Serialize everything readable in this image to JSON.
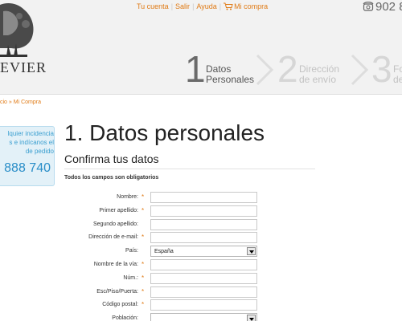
{
  "header": {
    "logo_word": "EVIER",
    "top_links": [
      "Tu cuenta",
      "Salir",
      "Ayuda"
    ],
    "cart_link": "Mi compra",
    "phone": "902 8",
    "steps": [
      {
        "num": "1",
        "line1": "Datos",
        "line2": "Personales",
        "state": "active"
      },
      {
        "num": "2",
        "line1": "Dirección",
        "line2": "de envío",
        "state": "inactive"
      },
      {
        "num": "3",
        "line1": "Fo",
        "line2": "de",
        "state": "inactive"
      }
    ]
  },
  "breadcrumb": {
    "parent": "cio",
    "separator": "»",
    "current": "Mi Compra"
  },
  "help_box": {
    "text": "lquier incidencia\ns e indícanos el\nde pedido",
    "phone": "888 740"
  },
  "main": {
    "title": "1. Datos personales",
    "subtitle": "Confirma tus datos",
    "required_note": "Todos los campos son obligatorios"
  },
  "form": {
    "fields": [
      {
        "label": "Nombre:",
        "required": true,
        "type": "text",
        "value": ""
      },
      {
        "label": "Primer apellido:",
        "required": true,
        "type": "text",
        "value": ""
      },
      {
        "label": "Segundo apellido:",
        "required": false,
        "type": "text",
        "value": ""
      },
      {
        "label": "Dirección de e-mail:",
        "required": true,
        "type": "text",
        "value": ""
      },
      {
        "label": "País:",
        "required": false,
        "type": "select",
        "value": "España"
      },
      {
        "label": "Nombre de la vía:",
        "required": true,
        "type": "text",
        "value": ""
      },
      {
        "label": "Núm.:",
        "required": true,
        "type": "text",
        "value": ""
      },
      {
        "label": "Esc/Piso/Puerta:",
        "required": true,
        "type": "text",
        "value": ""
      },
      {
        "label": "Código postal:",
        "required": true,
        "type": "text",
        "value": ""
      },
      {
        "label": "Población:",
        "required": false,
        "type": "select",
        "value": ""
      }
    ]
  },
  "colors": {
    "accent": "#e07b16",
    "help_blue": "#2a8ec8",
    "header_bg": "#f2f2f2"
  }
}
